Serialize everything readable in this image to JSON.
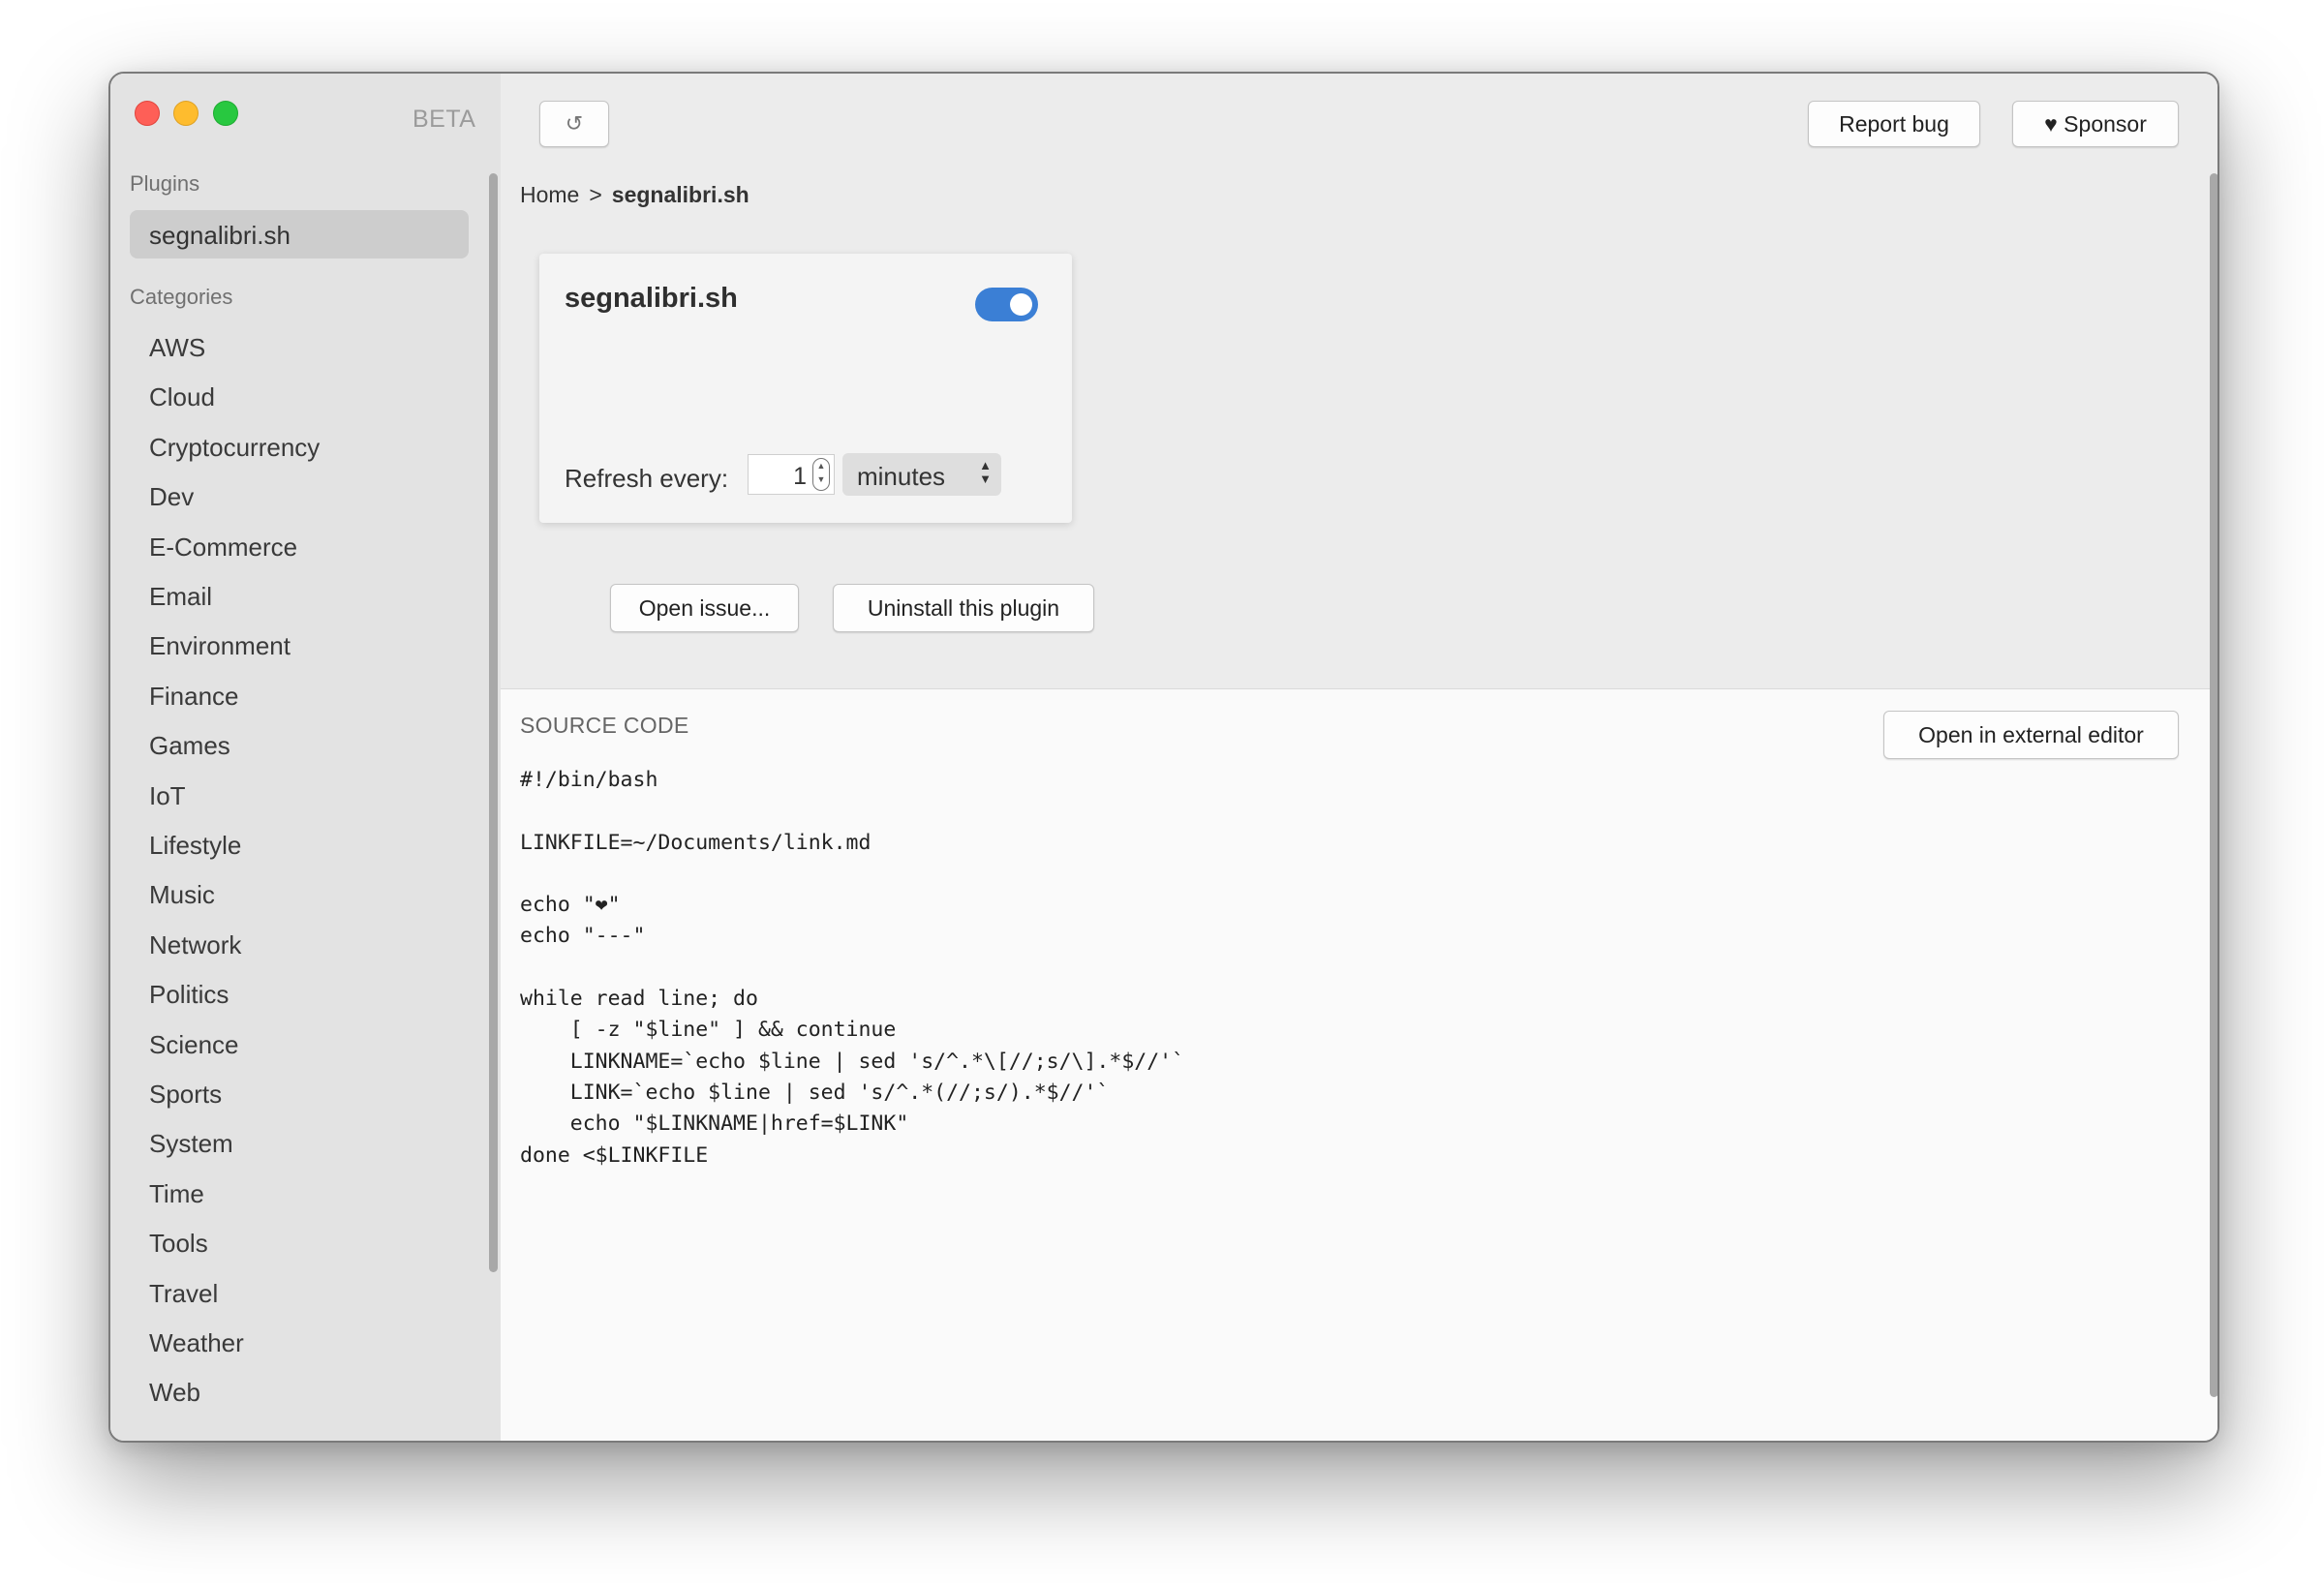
{
  "window": {
    "beta_label": "BETA",
    "traffic_lights": [
      "close",
      "minimize",
      "zoom"
    ],
    "colors": {
      "red": "#fe5f57",
      "yellow": "#febc2e",
      "green": "#28c840",
      "toggle_accent": "#3b7fd5"
    }
  },
  "sidebar": {
    "plugins_heading": "Plugins",
    "plugins": [
      "segnalibri.sh"
    ],
    "categories_heading": "Categories",
    "categories": [
      "AWS",
      "Cloud",
      "Cryptocurrency",
      "Dev",
      "E-Commerce",
      "Email",
      "Environment",
      "Finance",
      "Games",
      "IoT",
      "Lifestyle",
      "Music",
      "Network",
      "Politics",
      "Science",
      "Sports",
      "System",
      "Time",
      "Tools",
      "Travel",
      "Weather",
      "Web"
    ]
  },
  "toolbar": {
    "reload_icon": "↺",
    "report_bug": "Report bug",
    "sponsor": "♥ Sponsor"
  },
  "breadcrumb": {
    "home": "Home",
    "separator": ">",
    "current": "segnalibri.sh"
  },
  "plugin_card": {
    "title": "segnalibri.sh",
    "enabled": true,
    "refresh_label": "Refresh every:",
    "refresh_value": "1",
    "refresh_unit": "minutes"
  },
  "actions": {
    "open_issue": "Open issue...",
    "uninstall": "Uninstall this plugin"
  },
  "source": {
    "heading": "SOURCE CODE",
    "open_external": "Open in external editor",
    "code": "#!/bin/bash\n\nLINKFILE=~/Documents/link.md\n\necho \"❤\"\necho \"---\"\n\nwhile read line; do\n    [ -z \"$line\" ] && continue\n    LINKNAME=`echo $line | sed 's/^.*\\[//;s/\\].*$//'`\n    LINK=`echo $line | sed 's/^.*(//;s/).*$//'`\n    echo \"$LINKNAME|href=$LINK\"\ndone <$LINKFILE"
  }
}
